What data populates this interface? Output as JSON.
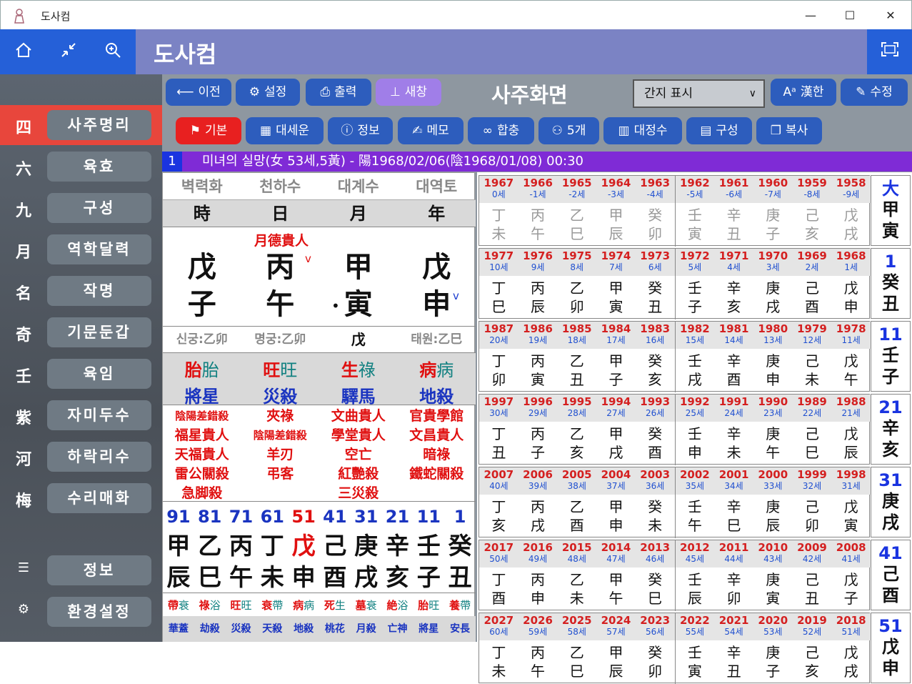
{
  "window": {
    "title": "도사컴",
    "min": "—",
    "max": "☐",
    "close": "✕"
  },
  "header": {
    "title": "도사컴"
  },
  "sidebar": {
    "items": [
      {
        "hz": "四",
        "label": "사주명리",
        "active": true
      },
      {
        "hz": "六",
        "label": "육효"
      },
      {
        "hz": "九",
        "label": "구성"
      },
      {
        "hz": "月",
        "label": "역학달력"
      },
      {
        "hz": "名",
        "label": "작명"
      },
      {
        "hz": "奇",
        "label": "기문둔갑"
      },
      {
        "hz": "壬",
        "label": "육임"
      },
      {
        "hz": "紫",
        "label": "자미두수"
      },
      {
        "hz": "河",
        "label": "하락리수"
      },
      {
        "hz": "梅",
        "label": "수리매화"
      }
    ],
    "bottom": [
      {
        "icon": "person-list-icon",
        "label": "정보"
      },
      {
        "icon": "gear-icon",
        "label": "환경설정"
      }
    ]
  },
  "toolbar1": {
    "prev": "이전",
    "settings": "설정",
    "print": "출력",
    "newwin": "새창",
    "title": "사주화면",
    "select": "간지 표시",
    "hanja": "漢한",
    "edit": "수정"
  },
  "toolbar2": {
    "basic": "기본",
    "daeseun": "대세운",
    "info": "정보",
    "memo": "메모",
    "hapchung": "합충",
    "five": "5개",
    "daejeongsu": "대정수",
    "gusung": "구성",
    "copy": "복사"
  },
  "info": {
    "num": "1",
    "text": "미녀의 실망(女 53세,5黃) - 陽1968/02/06(陰1968/01/08) 00:30"
  },
  "saju": {
    "napeum": [
      "벽력화",
      "천하수",
      "대계수",
      "대역토"
    ],
    "pillars": [
      "時",
      "日",
      "月",
      "年"
    ],
    "special": "月德貴人",
    "stems": [
      "戊",
      "丙",
      "甲",
      "戊"
    ],
    "branches": [
      "子",
      "午",
      "寅",
      "申"
    ],
    "gung": {
      "shin": "신궁:乙卯",
      "myung": "명궁:乙卯",
      "mid": "戊",
      "tae": "태원:乙巳"
    },
    "unseong": [
      [
        "胎",
        "胎"
      ],
      [
        "旺",
        "旺"
      ],
      [
        "生",
        "祿"
      ],
      [
        "病",
        "病"
      ]
    ],
    "sinsal": [
      "將星",
      "災殺",
      "驛馬",
      "地殺"
    ],
    "gilsin": [
      [
        "陰陽差錯殺",
        "福星貴人",
        "天福貴人",
        "雷公關殺",
        "急脚殺"
      ],
      [
        "夾祿",
        "陰陽差錯殺",
        "羊刃",
        "弔客"
      ],
      [
        "文曲貴人",
        "學堂貴人",
        "空亡",
        "紅艷殺",
        "三災殺"
      ],
      [
        "官貴學館",
        "文昌貴人",
        "暗祿",
        "鐵蛇關殺"
      ]
    ],
    "daeun_ages": [
      "91",
      "81",
      "71",
      "61",
      "51",
      "41",
      "31",
      "21",
      "11",
      "1"
    ],
    "daeun_stems": [
      "甲",
      "乙",
      "丙",
      "丁",
      "戊",
      "己",
      "庚",
      "辛",
      "壬",
      "癸"
    ],
    "daeun_branches": [
      "辰",
      "巳",
      "午",
      "未",
      "申",
      "酉",
      "戌",
      "亥",
      "子",
      "丑"
    ],
    "daeun_us": [
      [
        "帶",
        "衰"
      ],
      [
        "祿",
        "浴"
      ],
      [
        "旺",
        "旺"
      ],
      [
        "衰",
        "帶"
      ],
      [
        "病",
        "病"
      ],
      [
        "死",
        "生"
      ],
      [
        "墓",
        "衰"
      ],
      [
        "絶",
        "浴"
      ],
      [
        "胎",
        "旺"
      ],
      [
        "養",
        "帶"
      ]
    ],
    "daeun_ss": [
      "華蓋",
      "劫殺",
      "災殺",
      "天殺",
      "地殺",
      "桃花",
      "月殺",
      "亡神",
      "將星",
      "安長"
    ]
  },
  "yearblocks": [
    {
      "years": [
        "1967",
        "1966",
        "1965",
        "1964",
        "1963",
        "1962",
        "1961",
        "1960",
        "1959",
        "1958"
      ],
      "ages": [
        "0세",
        "-1세",
        "-2세",
        "-3세",
        "-4세",
        "-5세",
        "-6세",
        "-7세",
        "-8세",
        "-9세"
      ],
      "s": [
        "丁",
        "丙",
        "乙",
        "甲",
        "癸",
        "壬",
        "辛",
        "庚",
        "己",
        "戊"
      ],
      "b": [
        "未",
        "午",
        "巳",
        "辰",
        "卯",
        "寅",
        "丑",
        "子",
        "亥",
        "戌"
      ],
      "num": "大",
      "c1": "甲",
      "c2": "寅",
      "faded": true
    },
    {
      "years": [
        "1977",
        "1976",
        "1975",
        "1974",
        "1973",
        "1972",
        "1971",
        "1970",
        "1969",
        "1968"
      ],
      "ages": [
        "10세",
        "9세",
        "8세",
        "7세",
        "6세",
        "5세",
        "4세",
        "3세",
        "2세",
        "1세"
      ],
      "s": [
        "丁",
        "丙",
        "乙",
        "甲",
        "癸",
        "壬",
        "辛",
        "庚",
        "己",
        "戊"
      ],
      "b": [
        "巳",
        "辰",
        "卯",
        "寅",
        "丑",
        "子",
        "亥",
        "戌",
        "酉",
        "申"
      ],
      "num": "1",
      "c1": "癸",
      "c2": "丑"
    },
    {
      "years": [
        "1987",
        "1986",
        "1985",
        "1984",
        "1983",
        "1982",
        "1981",
        "1980",
        "1979",
        "1978"
      ],
      "ages": [
        "20세",
        "19세",
        "18세",
        "17세",
        "16세",
        "15세",
        "14세",
        "13세",
        "12세",
        "11세"
      ],
      "s": [
        "丁",
        "丙",
        "乙",
        "甲",
        "癸",
        "壬",
        "辛",
        "庚",
        "己",
        "戊"
      ],
      "b": [
        "卯",
        "寅",
        "丑",
        "子",
        "亥",
        "戌",
        "酉",
        "申",
        "未",
        "午"
      ],
      "num": "11",
      "c1": "壬",
      "c2": "子"
    },
    {
      "years": [
        "1997",
        "1996",
        "1995",
        "1994",
        "1993",
        "1992",
        "1991",
        "1990",
        "1989",
        "1988"
      ],
      "ages": [
        "30세",
        "29세",
        "28세",
        "27세",
        "26세",
        "25세",
        "24세",
        "23세",
        "22세",
        "21세"
      ],
      "s": [
        "丁",
        "丙",
        "乙",
        "甲",
        "癸",
        "壬",
        "辛",
        "庚",
        "己",
        "戊"
      ],
      "b": [
        "丑",
        "子",
        "亥",
        "戌",
        "酉",
        "申",
        "未",
        "午",
        "巳",
        "辰"
      ],
      "num": "21",
      "c1": "辛",
      "c2": "亥"
    },
    {
      "years": [
        "2007",
        "2006",
        "2005",
        "2004",
        "2003",
        "2002",
        "2001",
        "2000",
        "1999",
        "1998"
      ],
      "ages": [
        "40세",
        "39세",
        "38세",
        "37세",
        "36세",
        "35세",
        "34세",
        "33세",
        "32세",
        "31세"
      ],
      "s": [
        "丁",
        "丙",
        "乙",
        "甲",
        "癸",
        "壬",
        "辛",
        "庚",
        "己",
        "戊"
      ],
      "b": [
        "亥",
        "戌",
        "酉",
        "申",
        "未",
        "午",
        "巳",
        "辰",
        "卯",
        "寅"
      ],
      "num": "31",
      "c1": "庚",
      "c2": "戌"
    },
    {
      "years": [
        "2017",
        "2016",
        "2015",
        "2014",
        "2013",
        "2012",
        "2011",
        "2010",
        "2009",
        "2008"
      ],
      "ages": [
        "50세",
        "49세",
        "48세",
        "47세",
        "46세",
        "45세",
        "44세",
        "43세",
        "42세",
        "41세"
      ],
      "s": [
        "丁",
        "丙",
        "乙",
        "甲",
        "癸",
        "壬",
        "辛",
        "庚",
        "己",
        "戊"
      ],
      "b": [
        "酉",
        "申",
        "未",
        "午",
        "巳",
        "辰",
        "卯",
        "寅",
        "丑",
        "子"
      ],
      "num": "41",
      "c1": "己",
      "c2": "酉"
    },
    {
      "years": [
        "2027",
        "2026",
        "2025",
        "2024",
        "2023",
        "2022",
        "2021",
        "2020",
        "2019",
        "2018"
      ],
      "ages": [
        "60세",
        "59세",
        "58세",
        "57세",
        "56세",
        "55세",
        "54세",
        "53세",
        "52세",
        "51세"
      ],
      "s": [
        "丁",
        "丙",
        "乙",
        "甲",
        "癸",
        "壬",
        "辛",
        "庚",
        "己",
        "戊"
      ],
      "b": [
        "未",
        "午",
        "巳",
        "辰",
        "卯",
        "寅",
        "丑",
        "子",
        "亥",
        "戌"
      ],
      "num": "51",
      "c1": "戊",
      "c2": "申"
    }
  ]
}
